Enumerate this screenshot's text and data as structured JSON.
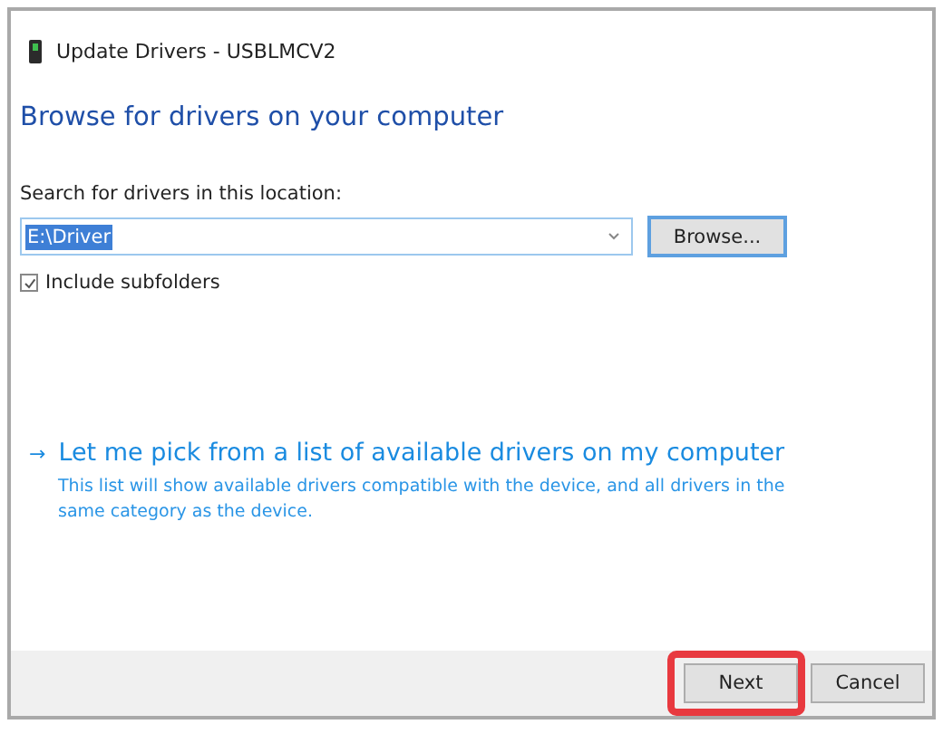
{
  "window": {
    "title": "Update Drivers - USBLMCV2"
  },
  "heading": "Browse for drivers on your computer",
  "location": {
    "label": "Search for drivers in this location:",
    "value": "E:\\Driver",
    "text_selected": true,
    "browse_button": "Browse..."
  },
  "include_subfolders": {
    "label": "Include subfolders",
    "checked": true
  },
  "pick_link": {
    "arrow": "→",
    "title": "Let me pick from a list of available drivers on my computer",
    "description": "This list will show available drivers compatible with the device, and all drivers in the same category as the device."
  },
  "buttons": [
    {
      "label": "Next",
      "highlighted": true
    },
    {
      "label": "Cancel",
      "highlighted": false
    }
  ]
}
